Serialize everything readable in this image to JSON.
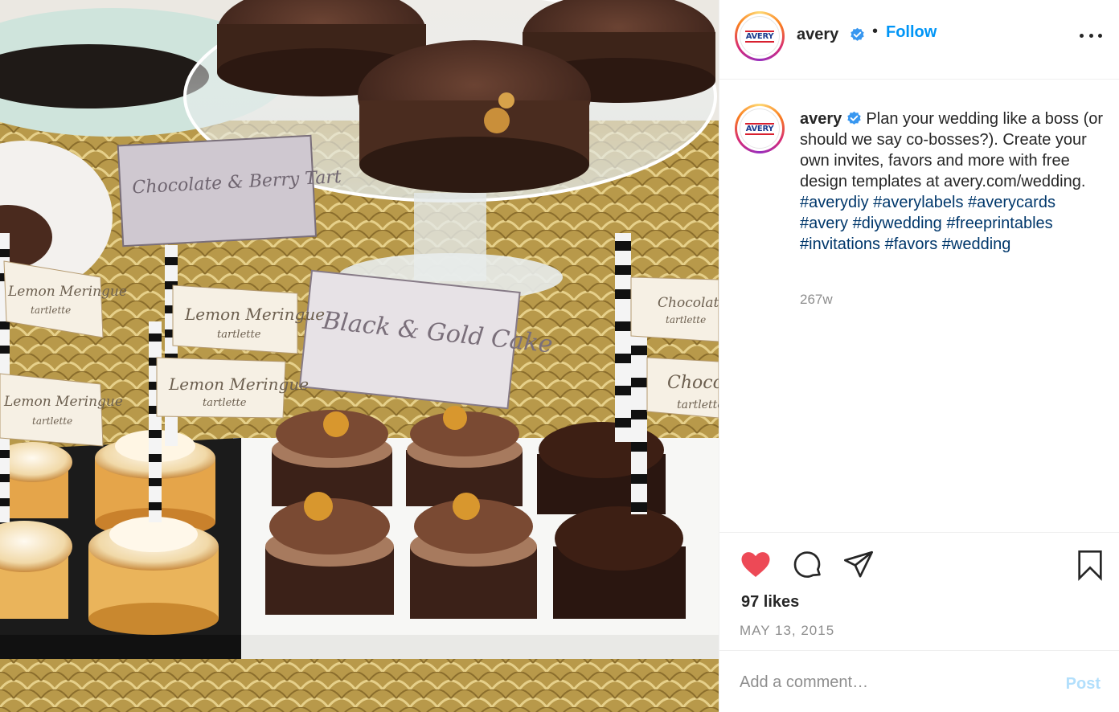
{
  "post": {
    "image_alt": "Dessert table with lemon meringue tartlettes, chocolate tartlettes and cakes",
    "image_labels": {
      "card1": "Chocolate & Berry Tart",
      "card2_line1": "Lemon Meringue",
      "card2_line2": "tartlette",
      "card3": "Black & Gold Cake",
      "card4_line1": "Chocolate",
      "card4_line2": "tartlette"
    }
  },
  "header": {
    "username": "avery",
    "separator": "•",
    "follow_label": "Follow"
  },
  "avatar": {
    "logo_text": "AVERY"
  },
  "caption": {
    "username": "avery",
    "text": "Plan your wedding like a boss (or should we say co-bosses?). Create your own invites, favors and more with free design templates at avery.com/wedding.",
    "hashtags": [
      "#averydiy",
      "#averylabels",
      "#averycards",
      "#avery",
      "#diywedding",
      "#freeprintables",
      "#invitations",
      "#favors",
      "#wedding"
    ],
    "time_ago": "267w"
  },
  "actions": {
    "likes": "97 likes",
    "date": "MAY 13, 2015",
    "liked": true
  },
  "comment": {
    "placeholder": "Add a comment…",
    "post_label": "Post"
  },
  "colors": {
    "follow": "#0095f6",
    "hashtag": "#00376b",
    "like_heart": "#ed4956",
    "verified": "#3897f0",
    "post_disabled": "#b2dffc"
  },
  "icons": [
    "verified-badge-icon",
    "more-options-icon",
    "heart-icon",
    "comment-icon",
    "share-icon",
    "bookmark-icon"
  ]
}
